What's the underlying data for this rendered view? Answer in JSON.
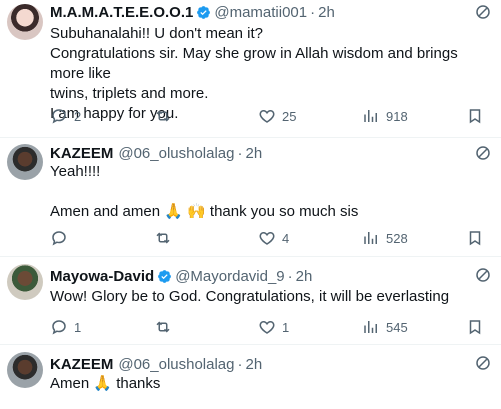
{
  "tweets": [
    {
      "name": "M.A.M.A.T.E.E.O.O.1",
      "verified": true,
      "handle": "@mamatii001",
      "time": "2h",
      "lines": [
        "Subuhanalahi!! U don't mean it?",
        "Congratulations sir. May she grow in Allah wisdom and brings more like",
        "twins, triplets and more.",
        "I am happy for you."
      ],
      "replies": "2",
      "retweets": "",
      "likes": "25",
      "views": "918"
    },
    {
      "name": "KAZEEM",
      "verified": false,
      "handle": "@06_olusholalag",
      "time": "2h",
      "lines": [
        "Yeah!!!!",
        "",
        "Amen and amen 🙏 🙌 thank you so much sis"
      ],
      "replies": "",
      "retweets": "",
      "likes": "4",
      "views": "528"
    },
    {
      "name": "Mayowa-David",
      "verified": true,
      "handle": "@Mayordavid_9",
      "time": "2h",
      "lines": [
        "Wow! Glory be to God. Congratulations, it will be everlasting"
      ],
      "replies": "1",
      "retweets": "",
      "likes": "1",
      "views": "545"
    },
    {
      "name": "KAZEEM",
      "verified": false,
      "handle": "@06_olusholalag",
      "time": "2h",
      "lines": [
        "Amen 🙏 thanks"
      ]
    }
  ],
  "separator": "·",
  "colors": {
    "text": "#0f1419",
    "muted": "#536471",
    "verified": "#1d9bf0",
    "divider": "#eff3f4"
  },
  "icons": [
    "verified-icon",
    "more-icon",
    "reply-icon",
    "retweet-icon",
    "like-icon",
    "views-icon",
    "bookmark-icon"
  ]
}
